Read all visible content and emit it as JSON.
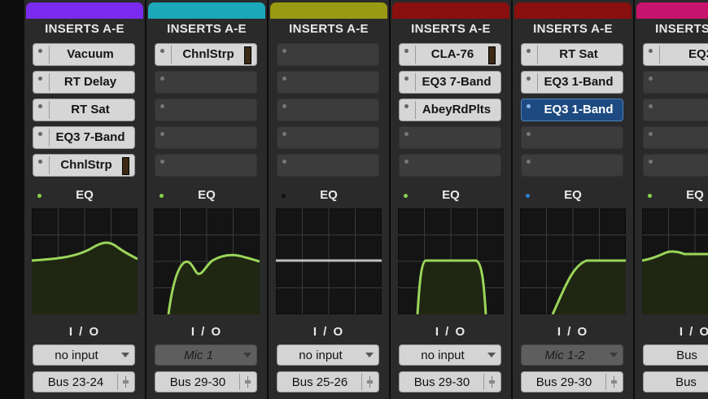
{
  "colors": {
    "strip_bg": "#2a2a2a",
    "eq_curve": "#9bd55a",
    "eq_fill": "#1f2612",
    "eq_grid": "#3a3a3a"
  },
  "strips": [
    {
      "color": "#7b2bf0",
      "inserts_label": "INSERTS A-E",
      "inserts": [
        {
          "name": "Vacuum",
          "state": "filled",
          "meter": false
        },
        {
          "name": "RT Delay",
          "state": "filled",
          "meter": false
        },
        {
          "name": "RT Sat",
          "state": "filled",
          "meter": false
        },
        {
          "name": "EQ3 7-Band",
          "state": "filled",
          "meter": false
        },
        {
          "name": "ChnlStrp",
          "state": "filled",
          "meter": true
        }
      ],
      "eq_label": "EQ",
      "eq_led": "green",
      "eq_curve": "bump",
      "io_label": "I / O",
      "input": "no input",
      "input_active": true,
      "output": "Bus 23-24"
    },
    {
      "color": "#1ba8b8",
      "inserts_label": "INSERTS A-E",
      "inserts": [
        {
          "name": "ChnlStrp",
          "state": "filled",
          "meter": true
        },
        {
          "name": "",
          "state": "empty"
        },
        {
          "name": "",
          "state": "empty"
        },
        {
          "name": "",
          "state": "empty"
        },
        {
          "name": "",
          "state": "empty"
        }
      ],
      "eq_label": "EQ",
      "eq_led": "green",
      "eq_curve": "lowcut-dip",
      "io_label": "I / O",
      "input": "Mic 1",
      "input_active": false,
      "output": "Bus 29-30"
    },
    {
      "color": "#9a9a12",
      "inserts_label": "INSERTS A-E",
      "inserts": [
        {
          "name": "",
          "state": "empty"
        },
        {
          "name": "",
          "state": "empty"
        },
        {
          "name": "",
          "state": "empty"
        },
        {
          "name": "",
          "state": "empty"
        },
        {
          "name": "",
          "state": "empty"
        }
      ],
      "eq_label": "EQ",
      "eq_led": "off",
      "eq_curve": "flat",
      "io_label": "I / O",
      "input": "no input",
      "input_active": true,
      "output": "Bus 25-26"
    },
    {
      "color": "#8a0f0f",
      "inserts_label": "INSERTS A-E",
      "inserts": [
        {
          "name": "CLA-76",
          "state": "filled",
          "meter": true
        },
        {
          "name": "EQ3 7-Band",
          "state": "filled",
          "meter": false
        },
        {
          "name": "AbeyRdPlts",
          "state": "filled",
          "meter": false
        },
        {
          "name": "",
          "state": "empty"
        },
        {
          "name": "",
          "state": "empty"
        }
      ],
      "eq_label": "EQ",
      "eq_led": "green",
      "eq_curve": "bandpass",
      "io_label": "I / O",
      "input": "no input",
      "input_active": true,
      "output": "Bus 29-30"
    },
    {
      "color": "#8a0f0f",
      "inserts_label": "INSERTS A-E",
      "inserts": [
        {
          "name": "RT Sat",
          "state": "filled",
          "meter": false
        },
        {
          "name": "EQ3 1-Band",
          "state": "filled",
          "meter": false
        },
        {
          "name": "EQ3 1-Band",
          "state": "selected",
          "meter": false
        },
        {
          "name": "",
          "state": "empty"
        },
        {
          "name": "",
          "state": "empty"
        }
      ],
      "eq_label": "EQ",
      "eq_led": "blue",
      "eq_curve": "highpass",
      "io_label": "I / O",
      "input": "Mic 1-2",
      "input_active": false,
      "output": "Bus 29-30"
    },
    {
      "color": "#c8136e",
      "inserts_label": "INSERTS A-E",
      "inserts": [
        {
          "name": "EQ3",
          "state": "filled",
          "meter": false
        },
        {
          "name": "",
          "state": "empty"
        },
        {
          "name": "",
          "state": "empty"
        },
        {
          "name": "",
          "state": "empty"
        },
        {
          "name": "",
          "state": "empty"
        }
      ],
      "eq_label": "EQ",
      "eq_led": "green",
      "eq_curve": "gentle",
      "io_label": "I / O",
      "input": "Bus",
      "input_active": true,
      "output": "Bus"
    }
  ]
}
